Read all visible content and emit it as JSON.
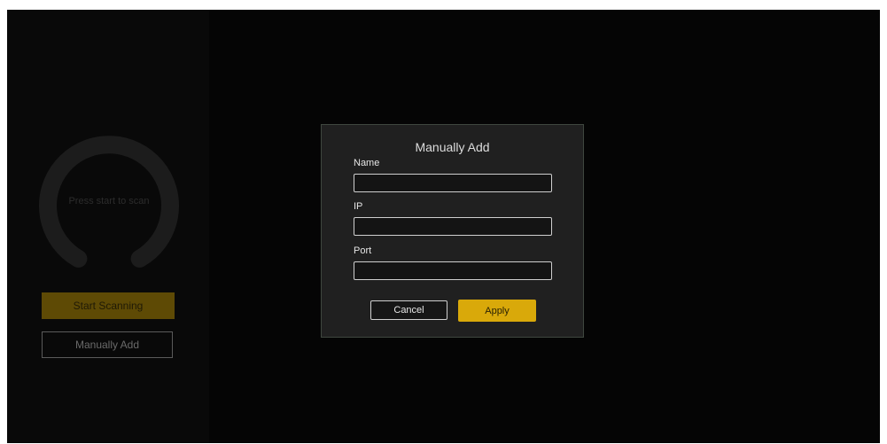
{
  "sidebar": {
    "scan_hint": "Press start to scan",
    "start_scanning_label": "Start Scanning",
    "manually_add_label": "Manually Add"
  },
  "dialog": {
    "title": "Manually Add",
    "fields": [
      {
        "label": "Name",
        "value": "",
        "placeholder": ""
      },
      {
        "label": "IP",
        "value": "",
        "placeholder": ""
      },
      {
        "label": "Port",
        "value": "",
        "placeholder": ""
      }
    ],
    "cancel_label": "Cancel",
    "apply_label": "Apply"
  },
  "colors": {
    "accent": "#d9a90a",
    "accent_dimmed": "#5e4a05",
    "background": "#050505",
    "dialog_background": "#202020",
    "ring": "#1c1c1c"
  }
}
